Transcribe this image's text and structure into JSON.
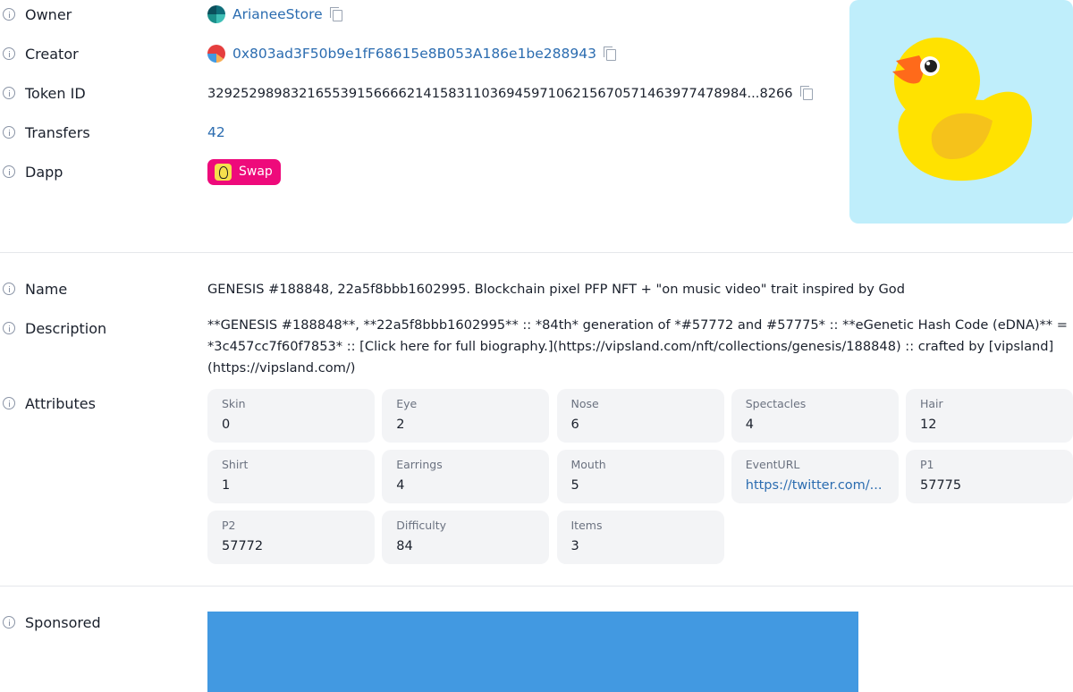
{
  "overview": {
    "owner": {
      "label": "Owner",
      "value": "ArianeeStore"
    },
    "creator": {
      "label": "Creator",
      "value": "0x803ad3F50b9e1fF68615e8B053A186e1be288943"
    },
    "token_id": {
      "label": "Token ID",
      "value": "32925298983216553915666621415831103694597106215670571463977478984...8266"
    },
    "transfers": {
      "label": "Transfers",
      "value": "42"
    },
    "dapp": {
      "label": "Dapp",
      "button_label": "Swap"
    }
  },
  "nft_image": {
    "icon": "rubber-duck-image",
    "background": "#bfeefb"
  },
  "details": {
    "name": {
      "label": "Name",
      "value": "GENESIS #188848, 22a5f8bbb1602995. Blockchain pixel PFP NFT + \"on music video\" trait inspired by God"
    },
    "description": {
      "label": "Description",
      "value": "**GENESIS #188848**, **22a5f8bbb1602995** :: *84th* generation of *#57772 and #57775* :: **eGenetic Hash Code (eDNA)** = *3c457cc7f60f7853* :: [Click here for full biography.](https://vipsland.com/nft/collections/genesis/188848) :: crafted by [vipsland](https://vipsland.com/)"
    },
    "attributes": {
      "label": "Attributes",
      "items": [
        {
          "name": "Skin",
          "value": "0"
        },
        {
          "name": "Eye",
          "value": "2"
        },
        {
          "name": "Nose",
          "value": "6"
        },
        {
          "name": "Spectacles",
          "value": "4"
        },
        {
          "name": "Hair",
          "value": "12"
        },
        {
          "name": "Shirt",
          "value": "1"
        },
        {
          "name": "Earrings",
          "value": "4"
        },
        {
          "name": "Mouth",
          "value": "5"
        },
        {
          "name": "EventURL",
          "value": "https://twitter.com/..."
        },
        {
          "name": "P1",
          "value": "57775"
        },
        {
          "name": "P2",
          "value": "57772"
        },
        {
          "name": "Difficulty",
          "value": "84"
        },
        {
          "name": "Items",
          "value": "3"
        }
      ]
    }
  },
  "sponsored": {
    "label": "Sponsored",
    "banner_color": "#4299e1"
  },
  "colors": {
    "link": "#2b6cb0",
    "dapp_button": "#ee0a7b",
    "card_bg": "#f3f4f6"
  }
}
